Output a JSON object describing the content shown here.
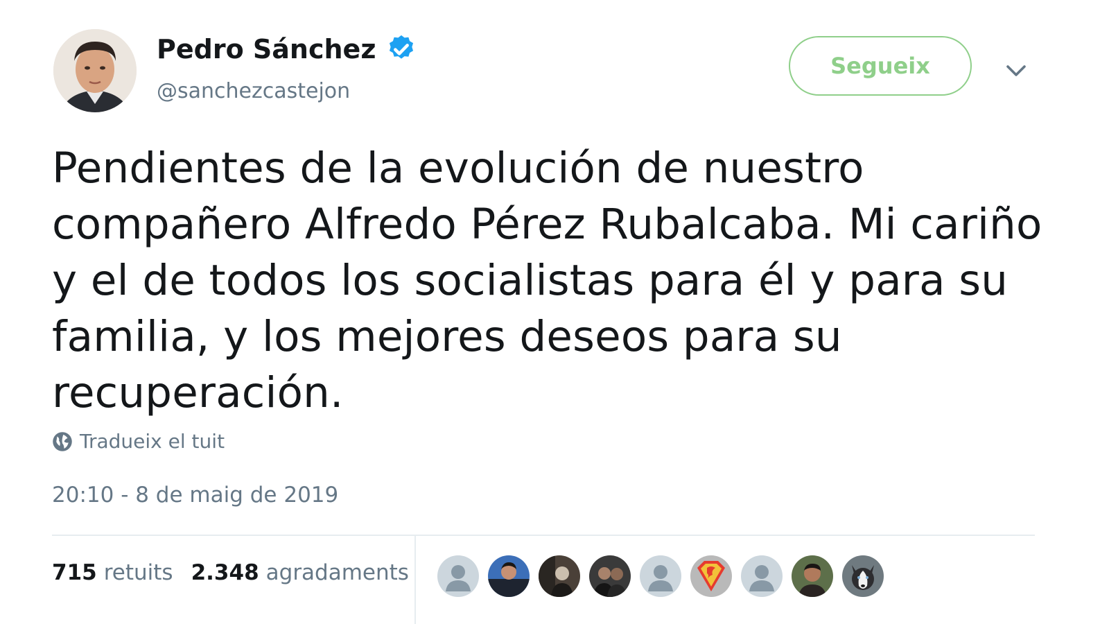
{
  "author": {
    "name": "Pedro Sánchez",
    "handle": "@sanchezcastejon",
    "verified": true
  },
  "header": {
    "follow_label": "Segueix"
  },
  "tweet": {
    "text": "Pendientes de la evolución de nuestro compañero Alfredo Pérez Rubalcaba. Mi cariño y el de todos los socialistas para él y para su familia, y los mejores deseos para su recuperación.",
    "translate_label": "Tradueix el tuit",
    "timestamp": "20:10 - 8 de maig de 2019"
  },
  "stats": {
    "retweets_count": "715",
    "retweets_label": "retuits",
    "likes_count": "2.348",
    "likes_label": "agradaments"
  },
  "likers": [
    {
      "type": "default-avatar-icon"
    },
    {
      "type": "photo",
      "bg": "#2b4a8a",
      "fg": "#1e2430"
    },
    {
      "type": "photo",
      "bg": "#4a4038",
      "fg": "#cbbfae"
    },
    {
      "type": "photo",
      "bg": "#3a3a3a",
      "fg": "#8c6a55"
    },
    {
      "type": "default-avatar-icon"
    },
    {
      "type": "superman-logo"
    },
    {
      "type": "default-avatar-icon"
    },
    {
      "type": "photo",
      "bg": "#5d6f4a",
      "fg": "#2a2422"
    },
    {
      "type": "husky-photo"
    }
  ],
  "colors": {
    "verified": "#1da1f2",
    "follow_accent": "#8fcf8a",
    "secondary_text": "#657786",
    "primary_text": "#14171a"
  }
}
